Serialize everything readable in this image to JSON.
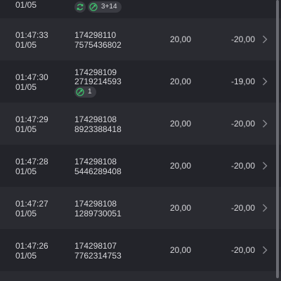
{
  "colors": {
    "badge_green": "#3ec46d",
    "text": "#d8d8dc",
    "chevron": "#8a8b92"
  },
  "rows": [
    {
      "time": "",
      "date": "01/05",
      "badges": {
        "refresh_icon": "refresh-icon",
        "pill_icon": "rocket-icon",
        "pill_text": "3+14"
      }
    },
    {
      "time": "01:47:33",
      "date": "01/05",
      "id1": "174298110",
      "id2": "7575436802",
      "amount": "20,00",
      "result": "-20,00"
    },
    {
      "time": "01:47:30",
      "date": "01/05",
      "id1": "174298109",
      "id2": "2719214593",
      "amount": "20,00",
      "result": "-19,00",
      "badges": {
        "pill_icon": "rocket-icon",
        "pill_text": "1"
      }
    },
    {
      "time": "01:47:29",
      "date": "01/05",
      "id1": "174298108",
      "id2": "8923388418",
      "amount": "20,00",
      "result": "-20,00"
    },
    {
      "time": "01:47:28",
      "date": "01/05",
      "id1": "174298108",
      "id2": "5446289408",
      "amount": "20,00",
      "result": "-20,00"
    },
    {
      "time": "01:47:27",
      "date": "01/05",
      "id1": "174298108",
      "id2": "1289730051",
      "amount": "20,00",
      "result": "-20,00"
    },
    {
      "time": "01:47:26",
      "date": "01/05",
      "id1": "174298107",
      "id2": "7762314753",
      "amount": "20,00",
      "result": "-20,00"
    }
  ]
}
